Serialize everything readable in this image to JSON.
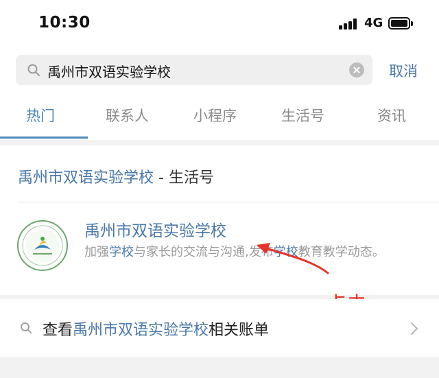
{
  "status_bar": {
    "time": "10:30",
    "network": "4G",
    "icons": [
      "signal-icon",
      "battery-icon"
    ]
  },
  "search": {
    "value": "禹州市双语实验学校",
    "cancel_label": "取消",
    "icons": [
      "search-icon",
      "clear-icon"
    ]
  },
  "tabs": [
    {
      "label": "热门",
      "active": true
    },
    {
      "label": "联系人",
      "active": false
    },
    {
      "label": "小程序",
      "active": false
    },
    {
      "label": "生活号",
      "active": false
    },
    {
      "label": "资讯",
      "active": false
    }
  ],
  "section": {
    "heading_highlight": "禹州市双语实验学校",
    "heading_rest": " - 生活号"
  },
  "result": {
    "title": "禹州市双语实验学校",
    "desc_parts": [
      "加强",
      "学校",
      "与家长的交流与沟通,发布",
      "学校",
      "教育教学动态。"
    ],
    "logo_icon": "school-logo-icon"
  },
  "annotation": {
    "label": "点击",
    "color": "#e53329"
  },
  "bills": {
    "prefix": "查看",
    "highlight": "禹州市双语实验学校",
    "suffix": "相关账单"
  },
  "colors": {
    "accent": "#4a78a8",
    "tab_active": "#4a86b8",
    "annotation": "#e53329"
  }
}
